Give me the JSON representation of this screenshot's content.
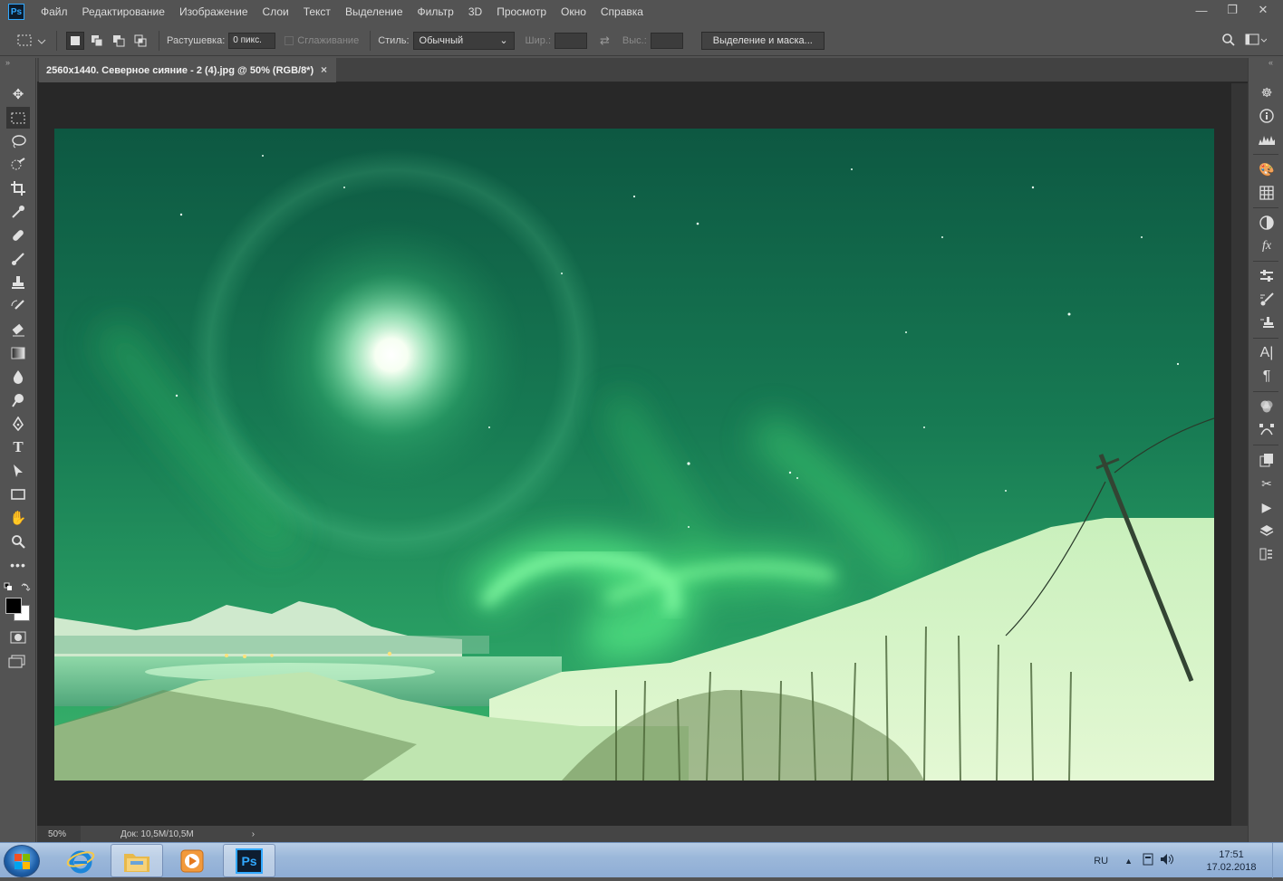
{
  "app": {
    "logo": "Ps"
  },
  "menu": [
    "Файл",
    "Редактирование",
    "Изображение",
    "Слои",
    "Текст",
    "Выделение",
    "Фильтр",
    "3D",
    "Просмотр",
    "Окно",
    "Справка"
  ],
  "window_controls": {
    "minimize": "—",
    "restore": "❐",
    "close": "✕"
  },
  "options": {
    "feather_label": "Растушевка:",
    "feather_value": "0 пикс.",
    "antialias_label": "Сглаживание",
    "style_label": "Стиль:",
    "style_value": "Обычный",
    "width_label": "Шир.:",
    "height_label": "Выс.:",
    "mask_button": "Выделение и маска..."
  },
  "document": {
    "tab_title": "2560x1440. Северное сияние - 2 (4).jpg @ 50% (RGB/8*)",
    "tab_close": "×",
    "zoom": "50%",
    "doc_info": "Док: 10,5M/10,5M",
    "status_arrow": "›"
  },
  "tools": [
    "move-icon",
    "marquee-icon",
    "lasso-icon",
    "quick-select-icon",
    "crop-icon",
    "eyedropper-icon",
    "healing-icon",
    "brush-icon",
    "stamp-icon",
    "history-brush-icon",
    "eraser-icon",
    "gradient-icon",
    "blur-icon",
    "dodge-icon",
    "pen-icon",
    "type-icon",
    "path-select-icon",
    "rectangle-icon",
    "hand-icon",
    "zoom-icon",
    "more-icon"
  ],
  "panels": [
    "navigator-icon",
    "info-icon",
    "histogram-icon",
    "color-icon",
    "swatches-icon",
    "adjustments-icon",
    "styles-icon",
    "properties-icon",
    "brush-settings-icon",
    "clone-source-icon",
    "character-icon",
    "paragraph-icon",
    "channels-icon",
    "paths-icon",
    "libraries-icon",
    "tools-preset-icon",
    "actions-icon",
    "layers-icon",
    "history-icon"
  ],
  "taskbar": {
    "language": "RU",
    "time": "17:51",
    "date": "17.02.2018"
  },
  "colors": {
    "sky_top": "#0f5a44",
    "sky_mid": "#1f8f5e",
    "aurora": "#4cf07c",
    "snow": "#d7f3c8"
  }
}
